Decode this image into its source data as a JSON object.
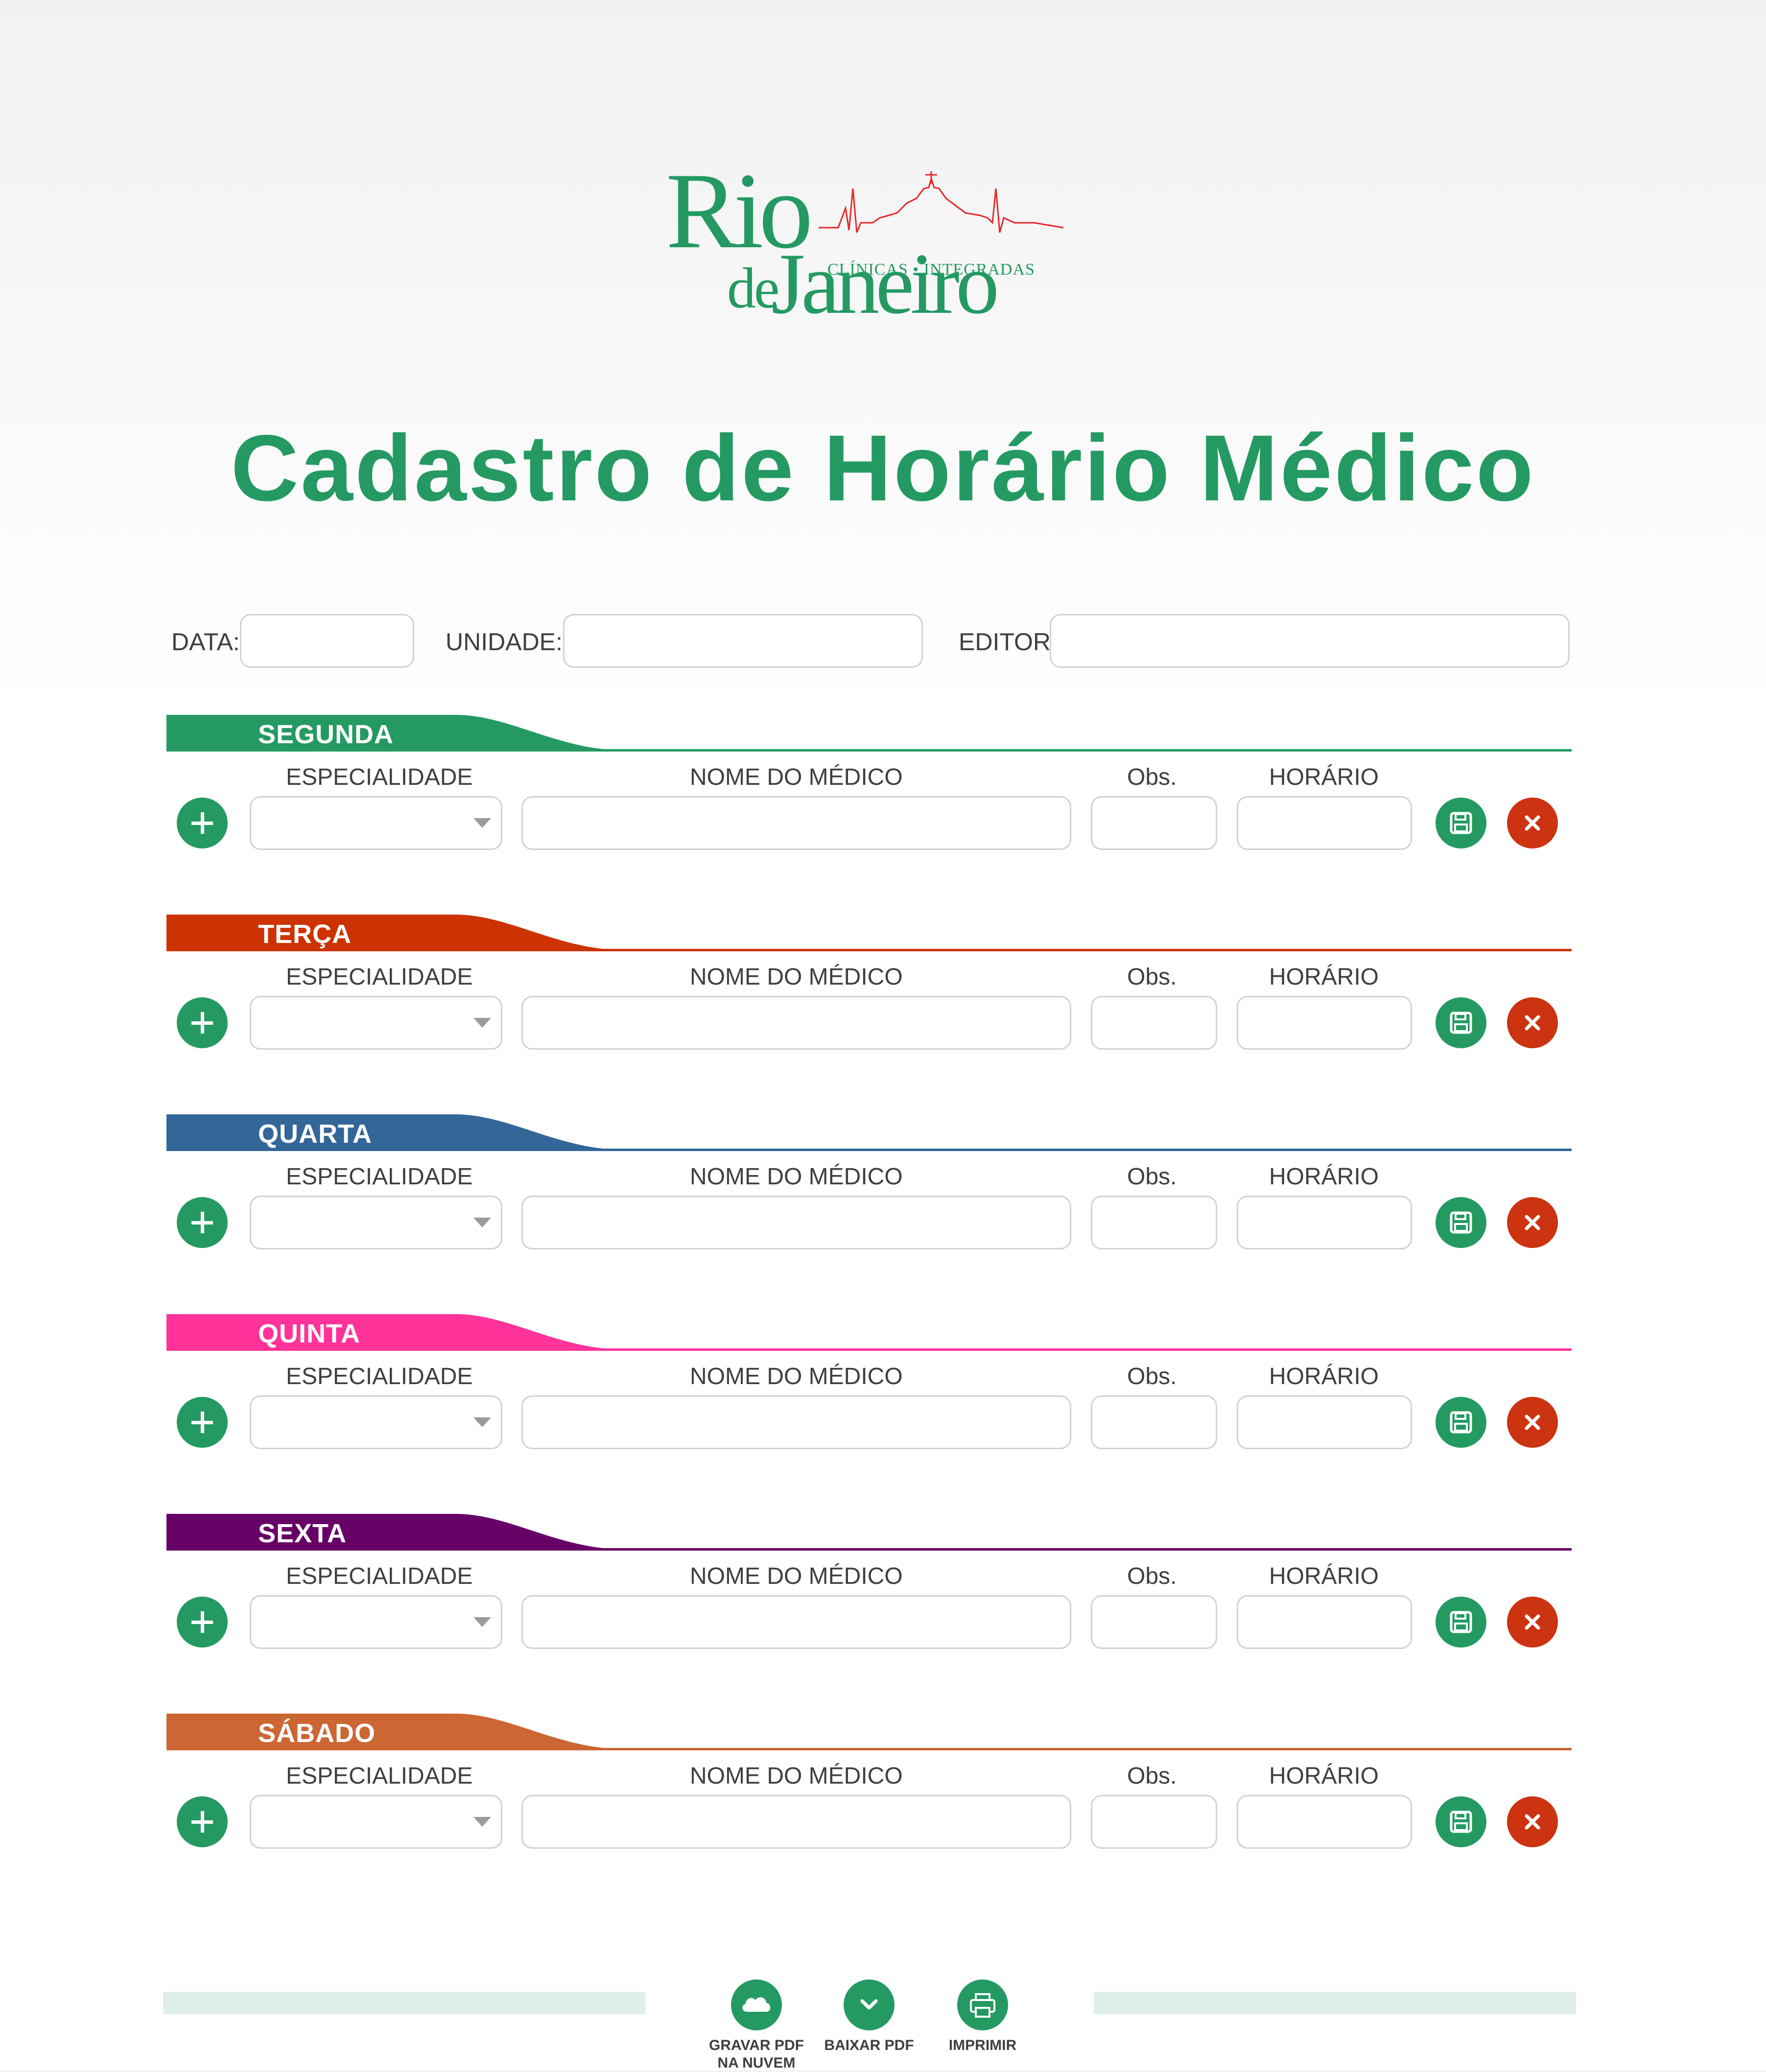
{
  "brand": {
    "logo_line1": "Rio",
    "logo_line2_small": "de",
    "logo_line2": "Janeiro",
    "logo_tagline": "CLÍNICAS • INTEGRADAS"
  },
  "page_title": "Cadastro de Horário Médico",
  "top_fields": {
    "data_label": "DATA:",
    "data_value": "",
    "unidade_label": "UNIDADE:",
    "unidade_value": "",
    "editor_label": "EDITOR:",
    "editor_value": ""
  },
  "columns": {
    "especialidade": "ESPECIALIDADE",
    "nome_medico": "NOME DO MÉDICO",
    "obs": "Obs.",
    "horario": "HORÁRIO"
  },
  "days": [
    {
      "name": "SEGUNDA",
      "color": "#249a62"
    },
    {
      "name": "TERÇA",
      "color": "#cc3300"
    },
    {
      "name": "QUARTA",
      "color": "#336699"
    },
    {
      "name": "QUINTA",
      "color": "#ff3399"
    },
    {
      "name": "SEXTA",
      "color": "#660066"
    },
    {
      "name": "SÁBADO",
      "color": "#cc6633"
    }
  ],
  "icons": {
    "add": "plus-icon",
    "save": "floppy-disk-icon",
    "delete": "close-icon",
    "dropdown": "chevron-down-icon",
    "cloud": "cloud-icon",
    "download": "chevron-down-icon",
    "print": "printer-icon"
  },
  "colors": {
    "accent": "#249a62",
    "danger": "#cc3311",
    "footer_bar": "#dff0e8"
  },
  "footer": {
    "gravar_line1": "GRAVAR PDF",
    "gravar_line2": "NA NUVEM",
    "baixar": "BAIXAR PDF",
    "imprimir": "IMPRIMIR"
  }
}
